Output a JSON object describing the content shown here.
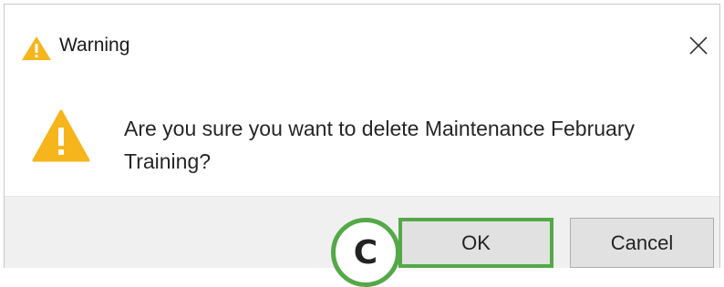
{
  "window": {
    "title": "Warning",
    "title_icon": "warning-triangle-icon",
    "close_icon": "close-icon"
  },
  "dialog": {
    "icon": "warning-triangle-icon",
    "message": "Are you sure you want to delete Maintenance February Training?"
  },
  "buttons": {
    "ok_label": "OK",
    "cancel_label": "Cancel"
  },
  "annotation": {
    "callout_label": "C"
  },
  "colors": {
    "warning": "#f5b51b",
    "highlight": "#54a848",
    "footer_bg": "#f0f0f0",
    "button_bg": "#e1e1e1"
  }
}
